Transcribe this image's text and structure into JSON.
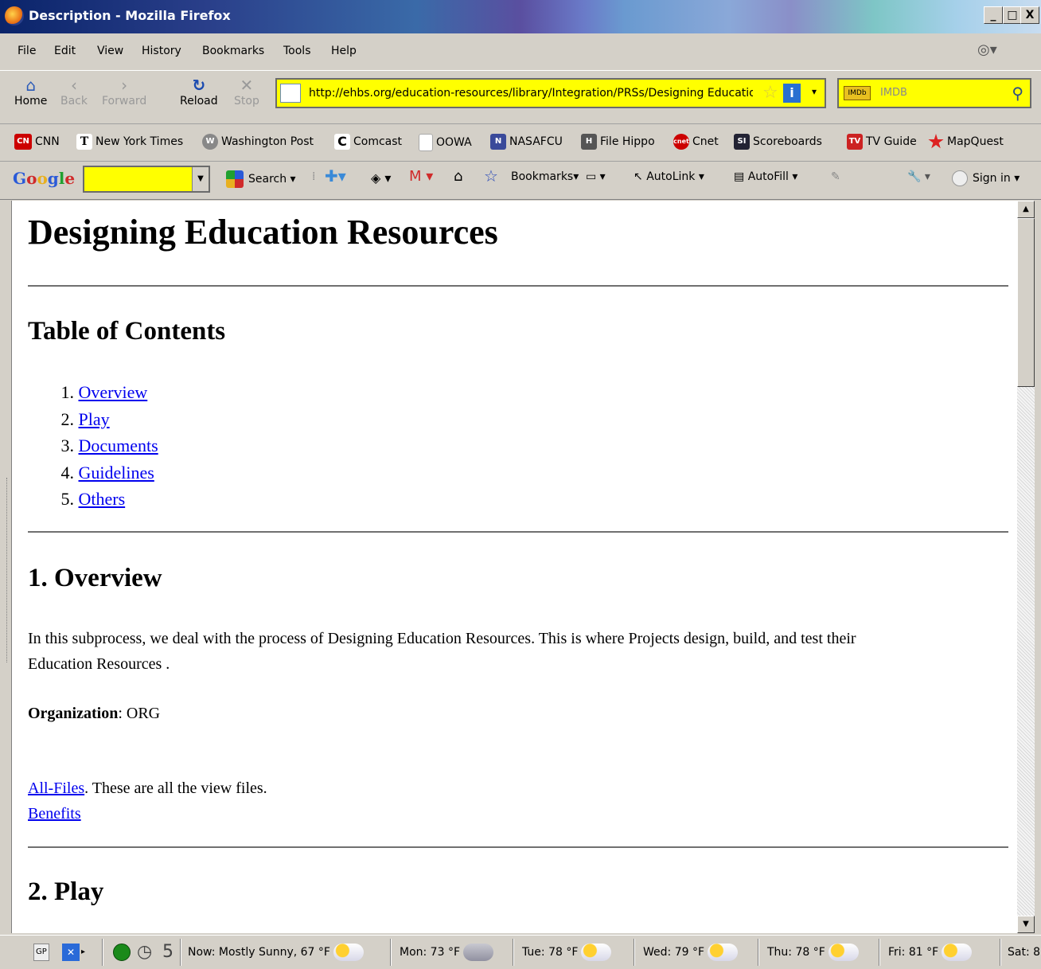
{
  "window": {
    "title": "Description - Mozilla Firefox",
    "min_label": "_",
    "max_label": "□",
    "close_label": "X"
  },
  "menubar": {
    "items": [
      "File",
      "Edit",
      "View",
      "History",
      "Bookmarks",
      "Tools",
      "Help"
    ]
  },
  "nav": {
    "home": "Home",
    "back": "Back",
    "forward": "Forward",
    "reload": "Reload",
    "stop": "Stop",
    "url": "http://ehbs.org/education-resources/library/Integration/PRSs/Designing Education Resources",
    "search_placeholder": "IMDB"
  },
  "bookmarks": [
    "CNN",
    "New York Times",
    "Washington Post",
    "Comcast",
    "OOWA",
    "NASAFCU",
    "File Hippo",
    "Cnet",
    "Scoreboards",
    "TV Guide",
    "MapQuest"
  ],
  "google_toolbar": {
    "logo": "Google",
    "search": "Search",
    "bookmarks": "Bookmarks",
    "autolink": "AutoLink",
    "autofill": "AutoFill",
    "signin": "Sign in"
  },
  "page": {
    "title": "Designing Education Resources",
    "toc_heading": "Table of Contents",
    "toc": [
      {
        "num": "1.",
        "label": "Overview"
      },
      {
        "num": "2.",
        "label": "Play"
      },
      {
        "num": "3.",
        "label": "Documents"
      },
      {
        "num": "4.",
        "label": "Guidelines"
      },
      {
        "num": "5.",
        "label": "Others"
      }
    ],
    "overview_heading": "1. Overview",
    "overview_line1": "In this subprocess, we deal with the process of Designing Education Resources. This is where Projects design, build, and test their",
    "overview_line2": "Education Resources .",
    "org_label": "Organization",
    "org_value": ": ORG",
    "allfiles_link": "All-Files",
    "allfiles_text": ". These are all the view files.",
    "benefits_link": "Benefits",
    "play_heading": "2. Play"
  },
  "statusbar": {
    "gp": "GP",
    "count": "5",
    "weather": [
      "Now: Mostly Sunny, 67 °F",
      "Mon: 73 °F",
      "Tue: 78 °F",
      "Wed: 79 °F",
      "Thu: 78 °F",
      "Fri: 81 °F",
      "Sat: 8"
    ]
  }
}
